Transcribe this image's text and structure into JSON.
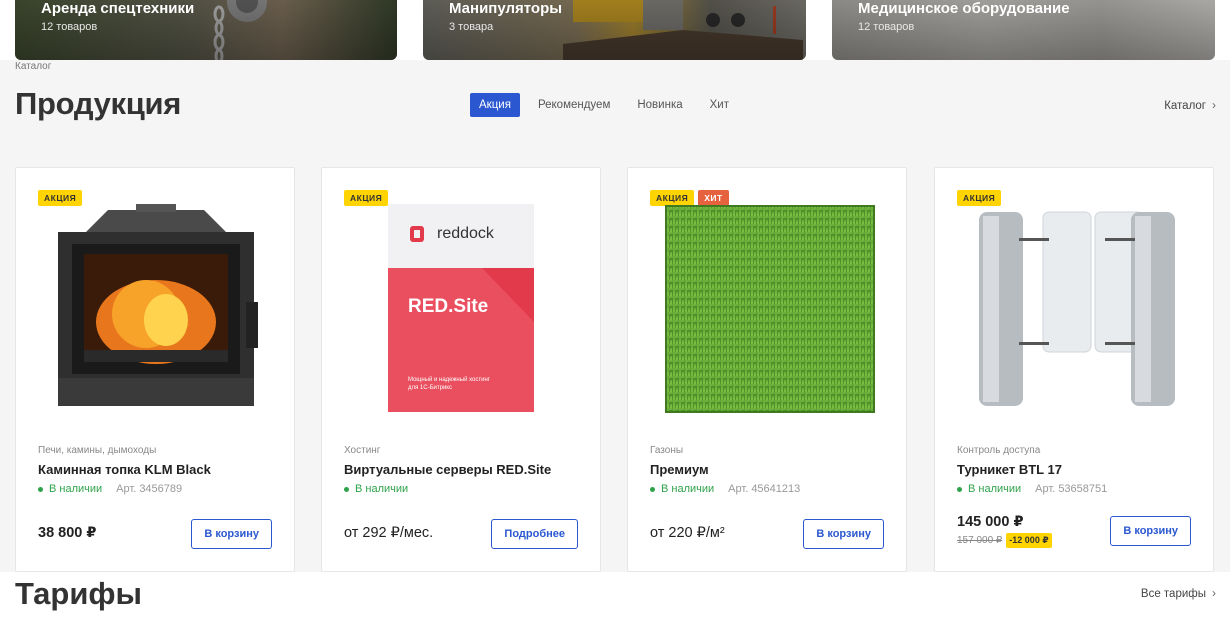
{
  "categories": [
    {
      "title": "Аренда спецтехники",
      "count": "12 товаров"
    },
    {
      "title": "Манипуляторы",
      "count": "3 товара"
    },
    {
      "title": "Медицинское оборудование",
      "count": "12 товаров"
    }
  ],
  "breadcrumb": "Каталог",
  "section_title": "Продукция",
  "tabs": [
    {
      "label": "Акция",
      "active": true
    },
    {
      "label": "Рекомендуем",
      "active": false
    },
    {
      "label": "Новинка",
      "active": false
    },
    {
      "label": "Хит",
      "active": false
    }
  ],
  "catalog_link": "Каталог",
  "products": [
    {
      "badges": [
        "АКЦИЯ"
      ],
      "category": "Печи, камины, дымоходы",
      "name": "Каминная топка KLM Black",
      "stock": "В наличии",
      "sku": "Арт. 3456789",
      "price": "38 800 ₽",
      "button": "В корзину"
    },
    {
      "badges": [
        "АКЦИЯ"
      ],
      "category": "Хостинг",
      "name": "Виртуальные серверы RED.Site",
      "stock": "В наличии",
      "sku": "",
      "price": "от 292 ₽/мес.",
      "button": "Подробнее",
      "box_brand": "reddock",
      "box_title": "RED.Site",
      "box_text": "Мощный и надежный хостинг для 1С-Битрикс"
    },
    {
      "badges": [
        "АКЦИЯ",
        "ХИТ"
      ],
      "category": "Газоны",
      "name": "Премиум",
      "stock": "В наличии",
      "sku": "Арт. 45641213",
      "price": "от 220 ₽/м²",
      "button": "В корзину"
    },
    {
      "badges": [
        "АКЦИЯ"
      ],
      "category": "Контроль доступа",
      "name": "Турникет BTL 17",
      "stock": "В наличии",
      "sku": "Арт. 53658751",
      "price": "145 000 ₽",
      "old_price": "157 000 ₽",
      "discount": "-12 000 ₽",
      "button": "В корзину"
    }
  ],
  "bottom_title": "Тарифы",
  "all_link": "Все тарифы",
  "colors": {
    "accent": "#2b58d1",
    "sale": "#ffd400",
    "hit": "#e6613e",
    "stock": "#2fa34a"
  },
  "icons": {
    "chevron": "chevron-right-icon"
  }
}
